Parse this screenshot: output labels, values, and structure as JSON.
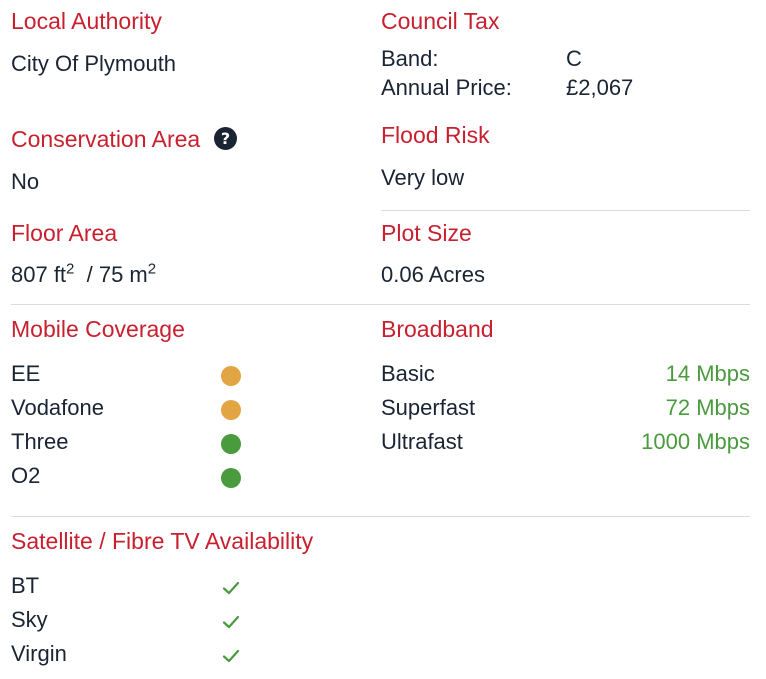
{
  "local_authority": {
    "heading": "Local Authority",
    "value": "City Of Plymouth"
  },
  "council_tax": {
    "heading": "Council Tax",
    "band_label": "Band:",
    "band_value": "C",
    "price_label": "Annual Price:",
    "price_value": "£2,067"
  },
  "conservation_area": {
    "heading": "Conservation Area",
    "help_icon": "question-circle-icon",
    "value": "No"
  },
  "flood_risk": {
    "heading": "Flood Risk",
    "value": "Very low"
  },
  "floor_area": {
    "heading": "Floor Area",
    "ft_value": "807 ft",
    "m_value": " / 75 m",
    "superscript": "2"
  },
  "plot_size": {
    "heading": "Plot Size",
    "value": "0.06 Acres"
  },
  "mobile_coverage": {
    "heading": "Mobile Coverage",
    "networks": [
      {
        "name": "EE",
        "status_color": "#e2a543"
      },
      {
        "name": "Vodafone",
        "status_color": "#e2a543"
      },
      {
        "name": "Three",
        "status_color": "#4a9a3e"
      },
      {
        "name": "O2",
        "status_color": "#4a9a3e"
      }
    ]
  },
  "broadband": {
    "heading": "Broadband",
    "speed_color": "#4a9a3e",
    "tiers": [
      {
        "name": "Basic",
        "speed": "14 Mbps"
      },
      {
        "name": "Superfast",
        "speed": "72 Mbps"
      },
      {
        "name": "Ultrafast",
        "speed": "1000 Mbps"
      }
    ]
  },
  "tv_availability": {
    "heading": "Satellite / Fibre TV Availability",
    "check_color": "#4a9a3e",
    "providers": [
      {
        "name": "BT",
        "icon": "checkmark-icon"
      },
      {
        "name": "Sky",
        "icon": "checkmark-icon"
      },
      {
        "name": "Virgin",
        "icon": "checkmark-icon"
      }
    ]
  },
  "colors": {
    "heading": "#c8202f",
    "text": "#1a2433",
    "divider": "#dcdcdc"
  }
}
